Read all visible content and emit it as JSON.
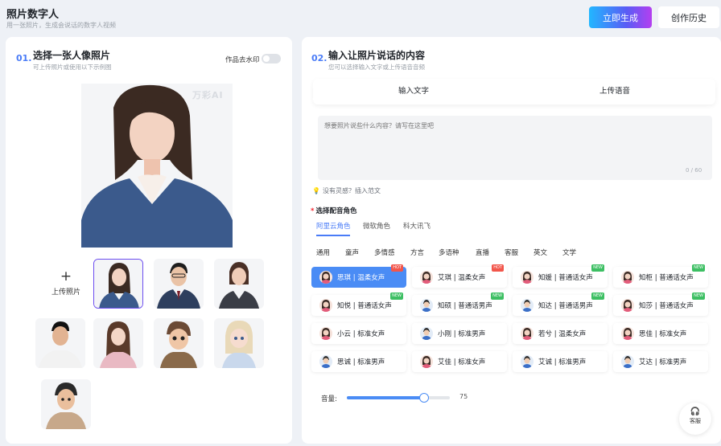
{
  "header": {
    "title": "照片数字人",
    "subtitle": "用一张照片，生成会说话的数字人视频",
    "generate_button": "立即生成",
    "history_button": "创作历史"
  },
  "left": {
    "step_num": "01.",
    "title": "选择一张人像照片",
    "subtitle": "可上传照片或使用以下示例图",
    "watermark_toggle_label": "作品去水印",
    "photo_watermark": "万彩AI",
    "upload_label": "上传照片"
  },
  "right": {
    "step_num": "02.",
    "title": "输入让照片说话的内容",
    "subtitle": "您可以选择输入文字或上传语音音频",
    "tabs": [
      "输入文字",
      "上传语音"
    ],
    "textarea_placeholder": "想要照片说些什么内容？请写在这里吧",
    "counter": "0 / 60",
    "hint": "没有灵感？插入范文",
    "voice_label": "选择配音角色",
    "providers": [
      "阿里云角色",
      "微软角色",
      "科大讯飞"
    ],
    "categories": [
      "通用",
      "童声",
      "多情感",
      "方言",
      "多语种",
      "直播",
      "客服",
      "英文",
      "文学"
    ],
    "voices": [
      {
        "name": "思琪 | 温柔女声",
        "badge": "HOT",
        "gender": "female"
      },
      {
        "name": "艾琪 | 温柔女声",
        "badge": "HOT",
        "gender": "female"
      },
      {
        "name": "知媛 | 普通话女声",
        "badge": "NEW",
        "gender": "female"
      },
      {
        "name": "知柜 | 普通话女声",
        "badge": "NEW",
        "gender": "female"
      },
      {
        "name": "知悦 | 普通话女声",
        "badge": "NEW",
        "gender": "female"
      },
      {
        "name": "知硕 | 普通话男声",
        "badge": "NEW",
        "gender": "male"
      },
      {
        "name": "知达 | 普通话男声",
        "badge": "NEW",
        "gender": "male"
      },
      {
        "name": "知莎 | 普通话女声",
        "badge": "NEW",
        "gender": "female"
      },
      {
        "name": "小云 | 标准女声",
        "badge": "",
        "gender": "female"
      },
      {
        "name": "小刚 | 标准男声",
        "badge": "",
        "gender": "male"
      },
      {
        "name": "若兮 | 温柔女声",
        "badge": "",
        "gender": "female"
      },
      {
        "name": "思佳 | 标准女声",
        "badge": "",
        "gender": "female"
      },
      {
        "name": "思诚 | 标准男声",
        "badge": "",
        "gender": "male"
      },
      {
        "name": "艾佳 | 标准女声",
        "badge": "",
        "gender": "female"
      },
      {
        "name": "艾诚 | 标准男声",
        "badge": "",
        "gender": "male"
      },
      {
        "name": "艾达 | 标准男声",
        "badge": "",
        "gender": "male"
      }
    ],
    "volume_label": "音量:",
    "volume_value": "75",
    "volume": 75,
    "service_label": "客服"
  },
  "colors": {
    "accent": "#4a7cf7",
    "selected_voice": "#4a8cf5",
    "hot_badge": "#f2564b",
    "new_badge": "#3dbf63"
  }
}
